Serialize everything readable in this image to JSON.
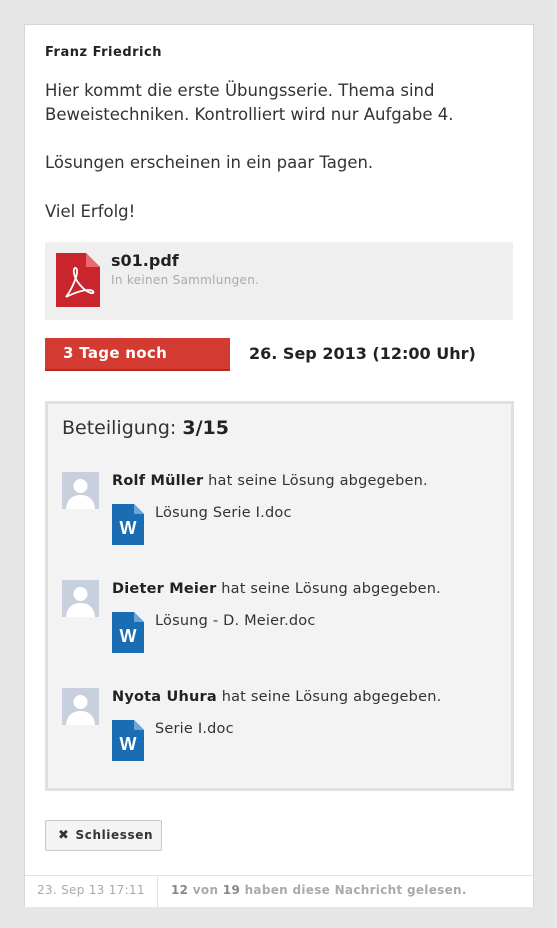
{
  "message": {
    "author": "Franz Friedrich",
    "lines": [
      "Hier kommt die erste Übungsserie. Thema sind",
      "Beweistechniken. Kontrolliert wird nur Aufgabe 4.",
      "Lösungen erscheinen in ein paar Tagen.",
      "Viel Erfolg!"
    ]
  },
  "attachment": {
    "icon": "pdf-file-icon",
    "name": "s01.pdf",
    "collections": "In keinen Sammlungen."
  },
  "deadline": {
    "remaining": "3 Tage noch",
    "date": "26. Sep 2013 (12:00 Uhr)",
    "color": "#d33a32"
  },
  "participation": {
    "label": "Beteiligung:",
    "value": "3/15",
    "submissions": [
      {
        "name": "Rolf Müller",
        "action": "hat seine Lösung abgegeben.",
        "file": "Lösung Serie I.doc",
        "file_icon": "word-file-icon"
      },
      {
        "name": "Dieter Meier",
        "action": "hat seine Lösung abgegeben.",
        "file": "Lösung - D. Meier.doc",
        "file_icon": "word-file-icon"
      },
      {
        "name": "Nyota Uhura",
        "action": "hat seine Lösung abgegeben.",
        "file": "Serie I.doc",
        "file_icon": "word-file-icon"
      }
    ]
  },
  "actions": {
    "close_label": "Schliessen",
    "close_icon": "close-x-icon"
  },
  "footer": {
    "timestamp": "23. Sep 13 17:11",
    "read_count": "12",
    "read_of": "von",
    "read_total": "19",
    "read_suffix": "haben diese Nachricht gelesen."
  }
}
